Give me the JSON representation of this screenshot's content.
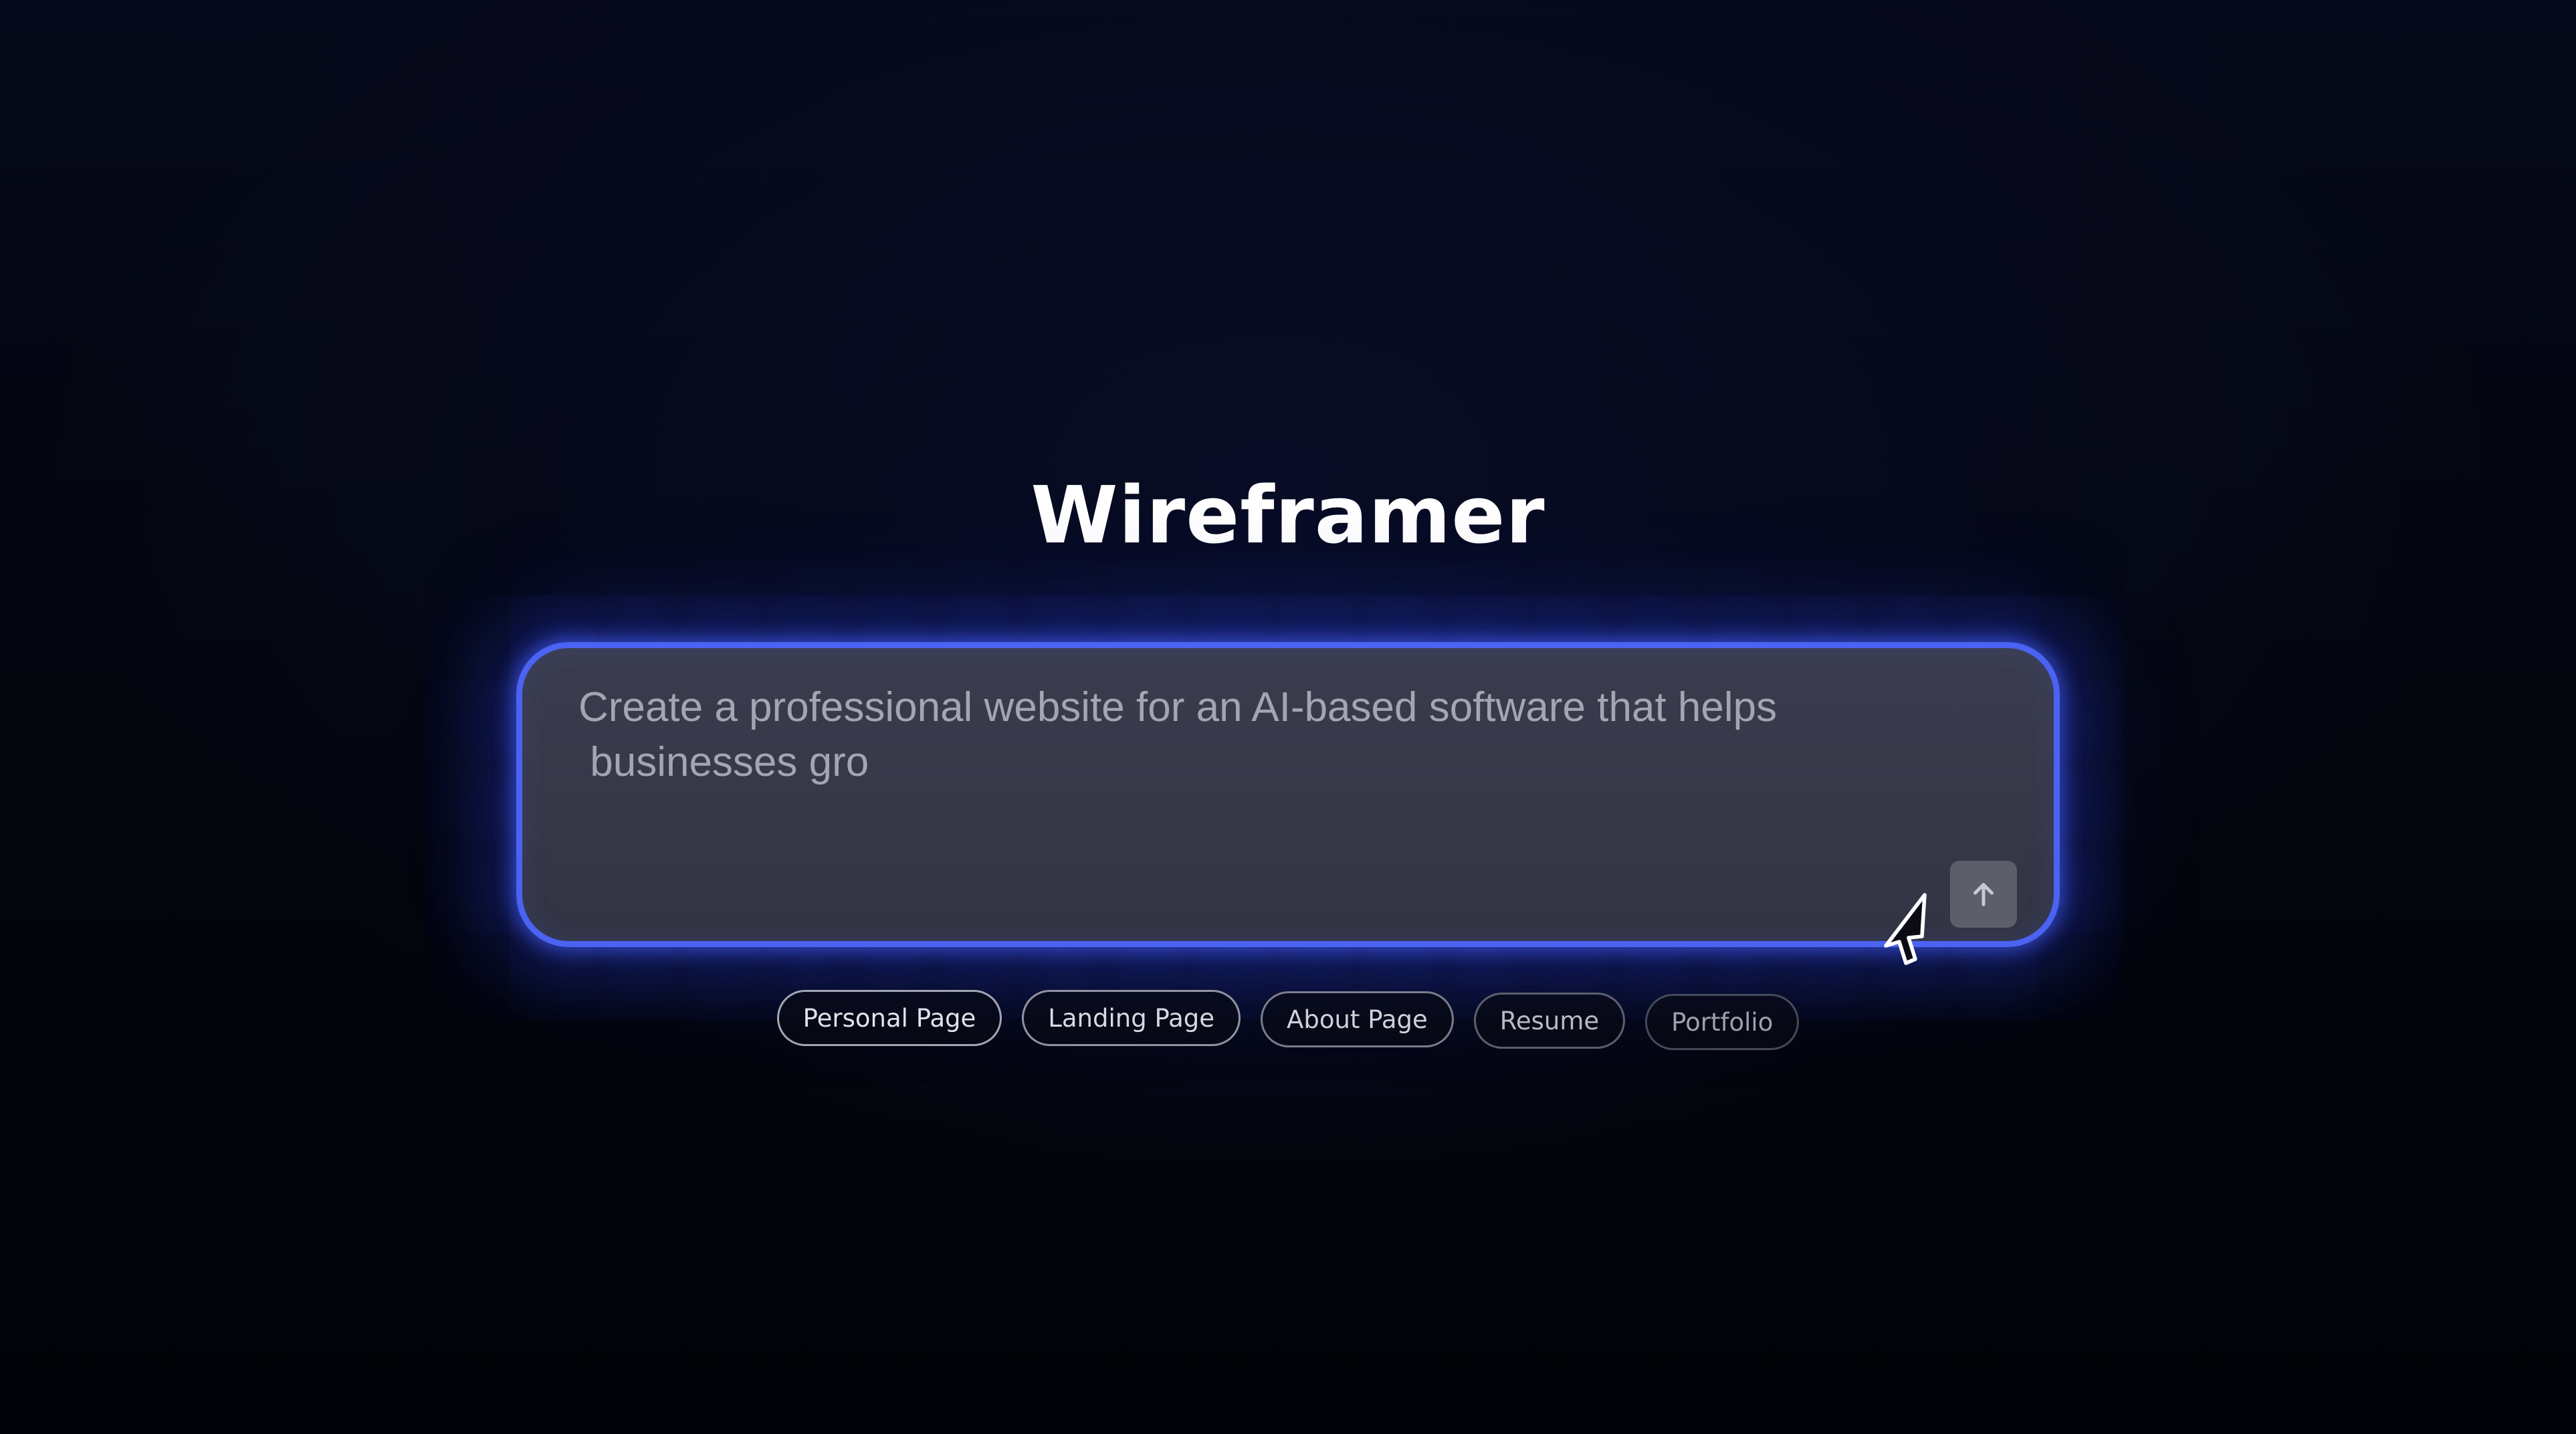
{
  "app": {
    "title": "Wireframer"
  },
  "prompt": {
    "value": "Create a professional website for an AI-based software that helps\n businesses gro",
    "send_icon": "arrow-up-icon"
  },
  "suggestions": [
    {
      "label": "Personal Page"
    },
    {
      "label": "Landing Page"
    },
    {
      "label": "About Page"
    },
    {
      "label": "Resume"
    },
    {
      "label": "Portfolio"
    }
  ],
  "colors": {
    "background": "#03050c",
    "accent_glow": "#4a63f2",
    "input_fill": "#373949",
    "title_text": "#ffffff"
  },
  "pointer_icon": "mouse-pointer-icon"
}
